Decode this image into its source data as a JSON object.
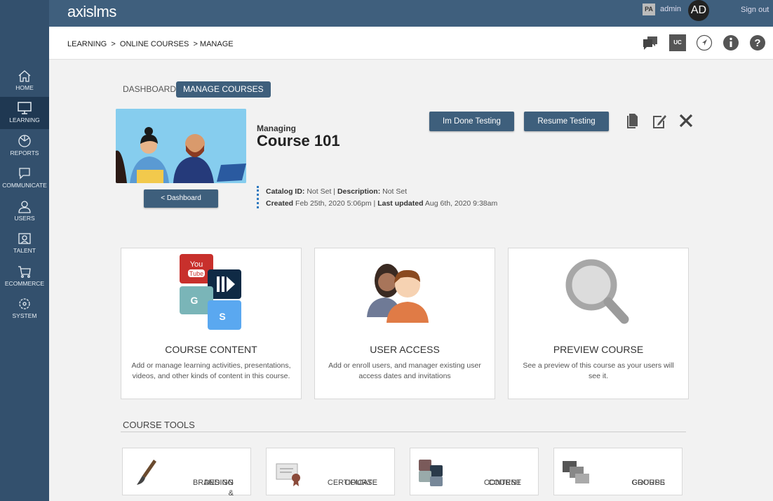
{
  "app": {
    "logo": "axislms",
    "user_badge": "PA",
    "username": "admin",
    "avatar": "AD",
    "sign_out": "Sign out"
  },
  "sidebar": {
    "items": [
      {
        "label": "HOME",
        "icon": "home-icon"
      },
      {
        "label": "LEARNING",
        "icon": "monitor-icon",
        "active": true
      },
      {
        "label": "REPORTS",
        "icon": "reports-icon"
      },
      {
        "label": "COMMUNICATE",
        "icon": "chat-icon"
      },
      {
        "label": "USERS",
        "icon": "user-icon"
      },
      {
        "label": "TALENT",
        "icon": "talent-icon"
      },
      {
        "label": "ECOMMERCE",
        "icon": "cart-icon"
      },
      {
        "label": "SYSTEM",
        "icon": "gear-icon"
      }
    ]
  },
  "breadcrumb": {
    "items": [
      "LEARNING",
      "ONLINE COURSES",
      "MANAGE"
    ]
  },
  "toolbar": {
    "uc_label": "UC",
    "icons": [
      "chat-bubbles-icon",
      "uc-icon",
      "navigate-icon",
      "info-icon",
      "help-icon"
    ]
  },
  "tabs": [
    {
      "label": "DASHBOARD"
    },
    {
      "label": "MANAGE COURSES",
      "active": true
    }
  ],
  "course": {
    "managing_label": "Managing",
    "title": "Course 101",
    "back_button": "< Dashboard",
    "done_testing": "Im Done Testing",
    "resume_testing": "Resume Testing",
    "catalog_label": "Catalog ID:",
    "catalog_value": "Not Set",
    "description_label": "Description:",
    "description_value": "Not Set",
    "created_label": "Created",
    "created_value": "Feb 25th, 2020 5:06pm",
    "updated_label": "Last updated",
    "updated_value": "Aug 6th, 2020 9:38am"
  },
  "cards": [
    {
      "title": "COURSE CONTENT",
      "text": "Add or manage learning activities, presentations, videos, and other kinds of content in this course."
    },
    {
      "title": "USER ACCESS",
      "text": "Add or enroll users, and manager existing user access dates and invitations"
    },
    {
      "title": "PREVIEW COURSE",
      "text": "See a preview of this course as your users will see it."
    }
  ],
  "tools": {
    "heading": "COURSE TOOLS",
    "items": [
      {
        "line1": "BRANDING &",
        "line2": "DESIGN"
      },
      {
        "line1": "COURSE",
        "line2": "CERTIFICATE"
      },
      {
        "line1": "COURSE",
        "line2": "CONTENT"
      },
      {
        "line1": "COURSE",
        "line2": "GROUPS"
      }
    ]
  },
  "colors": {
    "primary": "#3e5f7c",
    "sidebar": "#33506d",
    "sidebar_active": "#1f3852",
    "background": "#f2f2f2"
  }
}
